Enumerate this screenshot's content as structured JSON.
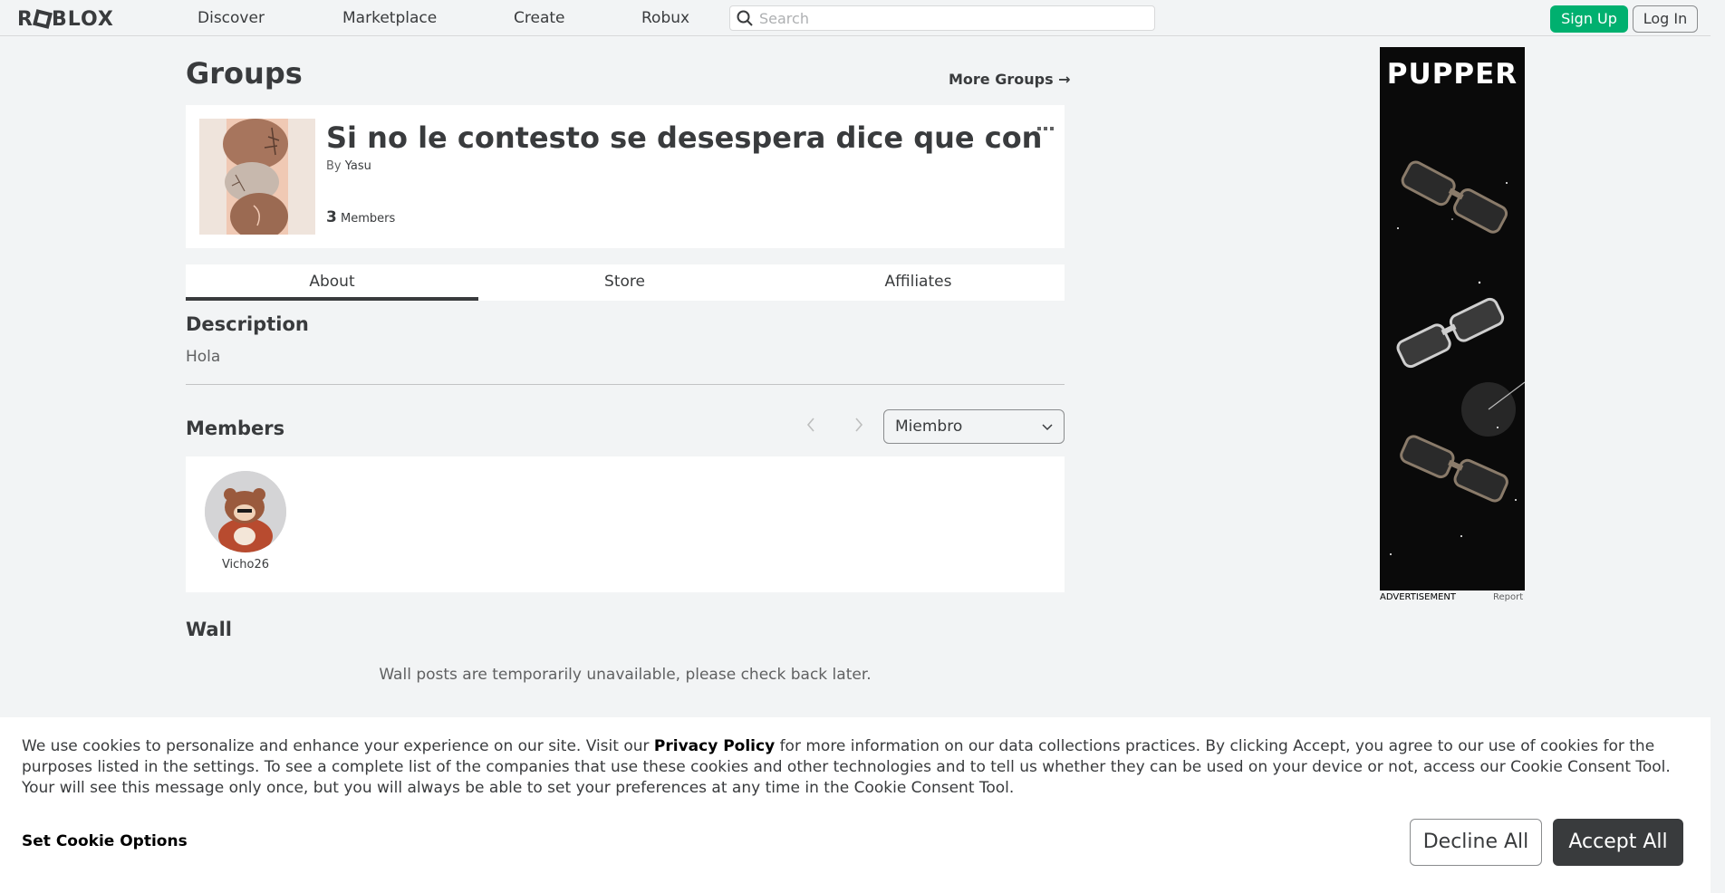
{
  "nav": {
    "logo": "ROBLOX",
    "links": [
      "Discover",
      "Marketplace",
      "Create",
      "Robux"
    ],
    "search_placeholder": "Search",
    "sign_up": "Sign Up",
    "log_in": "Log In"
  },
  "page": {
    "title": "Groups",
    "more_groups": "More Groups →"
  },
  "group": {
    "name": "Si no le contesto se desespera dice que con ...",
    "owner_label": "By",
    "owner_name": "Yasu",
    "member_count": "3",
    "members_label": "Members",
    "menu_icon": "ellipsis-icon"
  },
  "tabs": [
    "About",
    "Store",
    "Affiliates"
  ],
  "about": {
    "description_title": "Description",
    "description_text": "Hola",
    "members_title": "Members",
    "role_selected": "Miembro",
    "members": [
      {
        "name": "Vicho26"
      }
    ],
    "wall_title": "Wall",
    "wall_message": "Wall posts are temporarily unavailable, please check back later."
  },
  "ad": {
    "title": "PUPPER",
    "label": "ADVERTISEMENT",
    "report": "Report"
  },
  "cookie": {
    "text_1": "We use cookies to personalize and enhance your experience on our site. Visit our ",
    "privacy_link": "Privacy Policy",
    "text_2": " for more information on our data collections practices. By clicking Accept, you agree to our use of cookies for the purposes listed in the settings. To see a complete list of the companies that use these cookies and other technologies and to tell us whether they can be used on your device or not, access our Cookie Consent Tool. Your will see this message only once, but you will always be able to set your preferences at any time in the Cookie Consent Tool.",
    "set_options": "Set Cookie Options",
    "decline": "Decline All",
    "accept": "Accept All"
  },
  "colors": {
    "signup_green": "#00b06f",
    "dark_text": "#393b3d",
    "page_bg": "#f2f4f5",
    "accept_bg": "#393b3d"
  }
}
